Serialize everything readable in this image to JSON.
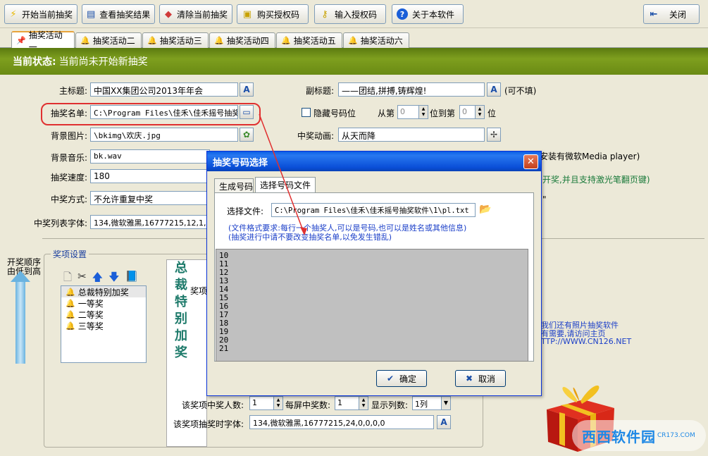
{
  "toolbar": {
    "start": "开始当前抽奖",
    "view_results": "查看抽奖结果",
    "clear": "清除当前抽奖",
    "buy_license": "购买授权码",
    "enter_license": "输入授权码",
    "about": "关于本软件",
    "close": "关闭"
  },
  "tabs": [
    "抽奖活动一",
    "抽奖活动二",
    "抽奖活动三",
    "抽奖活动四",
    "抽奖活动五",
    "抽奖活动六"
  ],
  "status": {
    "label": "当前状态:",
    "text": "当前尚未开始新抽奖"
  },
  "form": {
    "main_title_label": "主标题:",
    "main_title_value": "中国XX集团公司2013年年会",
    "subtitle_label": "副标题:",
    "subtitle_value": "——团结,拼搏,铸辉煌!",
    "subtitle_hint": "(可不填)",
    "list_label": "抽奖名单:",
    "list_value": "C:\\Program Files\\佳禾\\佳禾摇号抽奖",
    "hide_digits_label": "隐藏号码位",
    "from_label": "从第",
    "from_value": "0",
    "to_label": "位到第",
    "to_value": "0",
    "digit_label": "位",
    "bg_image_label": "背景图片:",
    "bg_image_value": "\\bkimg\\欢庆.jpg",
    "win_anim_label": "中奖动画:",
    "win_anim_value": "从天而降",
    "bg_music_label": "背景音乐:",
    "bg_music_value": "bk.wav",
    "music_hint": "安装有微软Media player)",
    "speed_label": "抽奖速度:",
    "speed_value": "180",
    "key_hint": "开奖,并且支持激光笔翻页键)",
    "win_mode_label": "中奖方式:",
    "win_mode_value": "不允许重复中奖",
    "quote_hint": "\"",
    "font_label": "中奖列表字体:",
    "font_value": "134,微软雅黑,16777215,12,1,"
  },
  "prize_section": {
    "order_label_1": "开奖顺序",
    "order_label_2": "由低到高",
    "group_title": "奖项设置",
    "items": [
      "总裁特别加奖",
      "一等奖",
      "二等奖",
      "三等奖"
    ],
    "vertical_title": "总裁特别加奖",
    "item_label": "奖项",
    "winners_label": "该奖项中奖人数:",
    "winners_value": "1",
    "per_screen_label": "每屏中奖数:",
    "per_screen_value": "1",
    "columns_label": "显示列数:",
    "columns_value": "1列",
    "draw_font_label": "该奖项抽奖时字体:",
    "draw_font_value": "134,微软雅黑,16777215,24,0,0,0,0"
  },
  "ads": {
    "line1": "我们还有照片抽奖软件",
    "line2": "有需要,请访问主页",
    "line3": "TTP://WWW.CN126.NET"
  },
  "dialog": {
    "title": "抽奖号码选择",
    "tab1": "生成号码",
    "tab2": "选择号码文件",
    "file_label": "选择文件:",
    "file_value": "C:\\Program Files\\佳禾\\佳禾摇号抽奖软件\\1\\pl.txt",
    "note1": "(文件格式要求:每行一个抽奖人,可以是号码,也可以是姓名或其他信息)",
    "note2": "(抽奖进行中请不要改变抽奖名单,以免发生错乱)",
    "numbers": [
      "10",
      "11",
      "12",
      "13",
      "14",
      "15",
      "16",
      "17",
      "18",
      "19",
      "20",
      "21"
    ],
    "ok": "确定",
    "cancel": "取消"
  },
  "watermark": {
    "brand": "西西软件园",
    "site": "CR173.COM"
  },
  "colors": {
    "status_bg": "#7e9f1e",
    "dialog_title": "#0a5fe6",
    "highlight": "#e03030",
    "note_blue": "#1a3ec8"
  }
}
